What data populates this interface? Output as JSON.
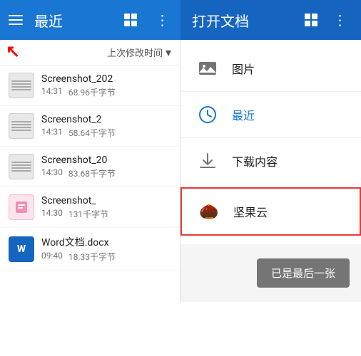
{
  "leftBar": {
    "title": "最近",
    "sortLabel": "上次修改时间",
    "files": [
      {
        "name": "Screenshot_202",
        "time": "14:31",
        "size": "68.96千字节",
        "type": "screenshot"
      },
      {
        "name": "Screenshot_2",
        "time": "14:31",
        "size": "58.64千字节",
        "type": "screenshot"
      },
      {
        "name": "Screenshot_20",
        "time": "14:30",
        "size": "83.68千字节",
        "type": "screenshot"
      },
      {
        "name": "Screenshot_",
        "time": "14:30",
        "size": "131千字节",
        "type": "screenshot-pink"
      },
      {
        "name": "Word文档.docx",
        "time": "09:40",
        "size": "18.33千字节",
        "type": "word"
      }
    ]
  },
  "rightBar": {
    "title": "打开文档",
    "menuItems": [
      {
        "label": "图片",
        "icon": "image",
        "selected": false
      },
      {
        "label": "最近",
        "icon": "clock",
        "selected": true
      },
      {
        "label": "下载内容",
        "icon": "download",
        "selected": false
      },
      {
        "label": "坚果云",
        "icon": "nut",
        "selected": false,
        "highlighted": true
      }
    ],
    "doneButton": "已是最后一张"
  }
}
